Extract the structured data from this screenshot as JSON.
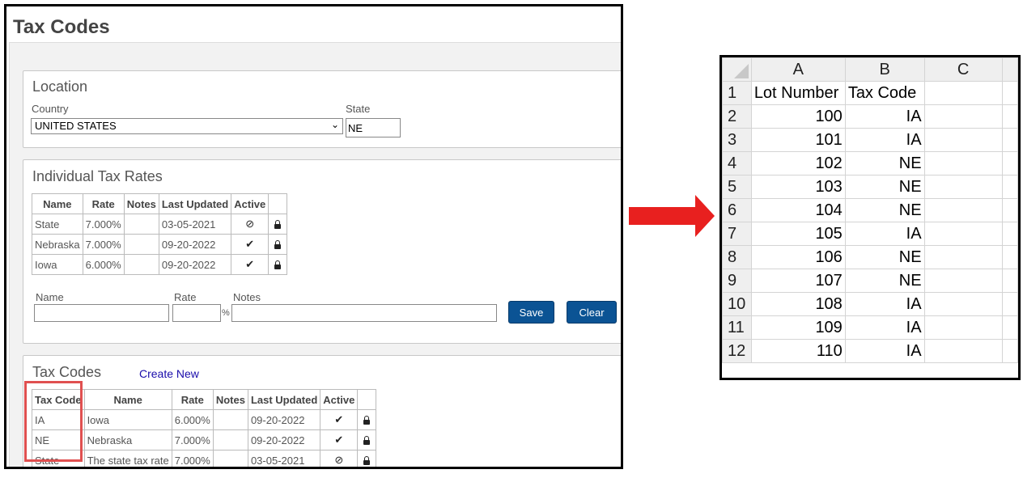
{
  "app": {
    "title": "Tax Codes",
    "location": {
      "heading": "Location",
      "country_label": "Country",
      "country_value": "UNITED STATES",
      "state_label": "State",
      "state_value": "NE"
    },
    "individual_rates": {
      "heading": "Individual Tax Rates",
      "columns": [
        "Name",
        "Rate",
        "Notes",
        "Last Updated",
        "Active",
        ""
      ],
      "rows": [
        {
          "name": "State",
          "rate": "7.000%",
          "notes": "",
          "updated": "03-05-2021",
          "active": "⊘"
        },
        {
          "name": "Nebraska",
          "rate": "7.000%",
          "notes": "",
          "updated": "09-20-2022",
          "active": "✔"
        },
        {
          "name": "Iowa",
          "rate": "6.000%",
          "notes": "",
          "updated": "09-20-2022",
          "active": "✔"
        }
      ],
      "form": {
        "name_label": "Name",
        "rate_label": "Rate",
        "percent": "%",
        "notes_label": "Notes",
        "save": "Save",
        "clear": "Clear"
      }
    },
    "tax_codes": {
      "heading": "Tax Codes",
      "create_new": "Create New",
      "columns": [
        "Tax Code",
        "Name",
        "Rate",
        "Notes",
        "Last Updated",
        "Active",
        ""
      ],
      "rows": [
        {
          "code": "IA",
          "name": "Iowa",
          "rate": "6.000%",
          "notes": "",
          "updated": "09-20-2022",
          "active": "✔"
        },
        {
          "code": "NE",
          "name": "Nebraska",
          "rate": "7.000%",
          "notes": "",
          "updated": "09-20-2022",
          "active": "✔"
        },
        {
          "code": "State",
          "name": "The state tax rate",
          "rate": "7.000%",
          "notes": "",
          "updated": "03-05-2021",
          "active": "⊘"
        }
      ]
    }
  },
  "arrow_color": "#e8201f",
  "highlight_color": "#e05050",
  "spreadsheet": {
    "columns": [
      "A",
      "B",
      "C"
    ],
    "rows": [
      {
        "n": "1",
        "a": "Lot Number",
        "b": "Tax Code",
        "c": ""
      },
      {
        "n": "2",
        "a": "100",
        "b": "IA",
        "c": ""
      },
      {
        "n": "3",
        "a": "101",
        "b": "IA",
        "c": ""
      },
      {
        "n": "4",
        "a": "102",
        "b": "NE",
        "c": ""
      },
      {
        "n": "5",
        "a": "103",
        "b": "NE",
        "c": ""
      },
      {
        "n": "6",
        "a": "104",
        "b": "NE",
        "c": ""
      },
      {
        "n": "7",
        "a": "105",
        "b": "IA",
        "c": ""
      },
      {
        "n": "8",
        "a": "106",
        "b": "NE",
        "c": ""
      },
      {
        "n": "9",
        "a": "107",
        "b": "NE",
        "c": ""
      },
      {
        "n": "10",
        "a": "108",
        "b": "IA",
        "c": ""
      },
      {
        "n": "11",
        "a": "109",
        "b": "IA",
        "c": ""
      },
      {
        "n": "12",
        "a": "110",
        "b": "IA",
        "c": ""
      }
    ]
  }
}
